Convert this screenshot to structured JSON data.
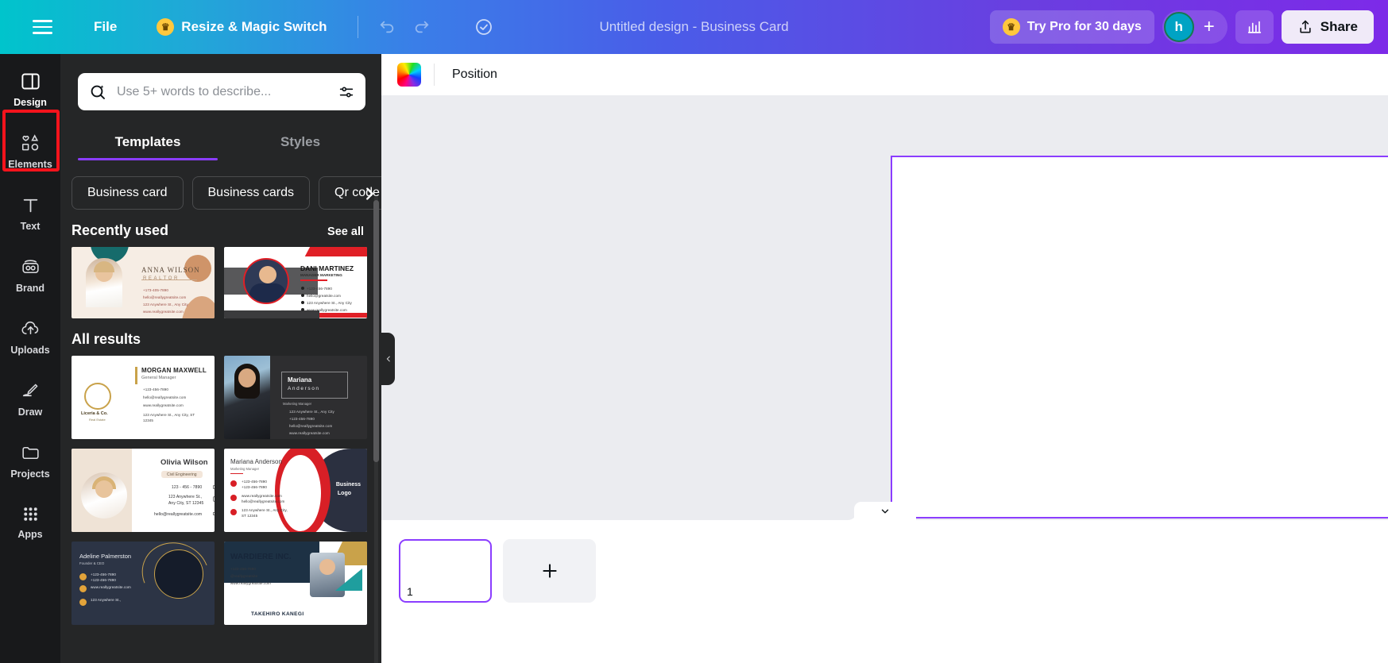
{
  "topbar": {
    "menu_icon": "hamburger-icon",
    "file_label": "File",
    "resize_label": "Resize & Magic Switch",
    "crown_icon": "crown-icon",
    "undo_icon": "undo-icon",
    "redo_icon": "redo-icon",
    "cloud_saved_icon": "cloud-check-icon",
    "design_title": "Untitled design - Business Card",
    "try_pro_label": "Try Pro for 30 days",
    "avatar_initial": "h",
    "add_member_icon": "plus-icon",
    "insights_icon": "bar-chart-icon",
    "share_label": "Share",
    "share_icon": "upload-icon",
    "gradient_start": "#00c4cc",
    "gradient_end": "#7d2ae8"
  },
  "rail": {
    "items": [
      {
        "label": "Design",
        "icon": "layout-panel-icon",
        "active": true
      },
      {
        "label": "Elements",
        "icon": "shapes-icon",
        "active": false
      },
      {
        "label": "Text",
        "icon": "text-t-icon",
        "active": false
      },
      {
        "label": "Brand",
        "icon": "brand-co-icon",
        "active": false
      },
      {
        "label": "Uploads",
        "icon": "cloud-upload-icon",
        "active": false
      },
      {
        "label": "Draw",
        "icon": "pencil-draw-icon",
        "active": false
      },
      {
        "label": "Projects",
        "icon": "folder-icon",
        "active": false
      },
      {
        "label": "Apps",
        "icon": "grid-dots-icon",
        "active": false
      }
    ],
    "highlight_color": "#f4131c"
  },
  "panel": {
    "search": {
      "placeholder": "Use 5+ words to describe...",
      "value": "",
      "magic_search_icon": "magic-search-icon",
      "filter_icon": "sliders-icon"
    },
    "tabs": [
      {
        "label": "Templates",
        "active": true
      },
      {
        "label": "Styles",
        "active": false
      }
    ],
    "active_tab_underline_color": "#8b3dff",
    "chips": [
      "Business card",
      "Business cards",
      "Qr code"
    ],
    "chips_next_icon": "chevron-right-icon",
    "sections": [
      {
        "title": "Recently used",
        "action_label": "See all",
        "cards": [
          {
            "name": "ANNA WILSON",
            "role": "REALTOR",
            "lines": [
              "+173-405-7890",
              "hello@reallygreatsite.com",
              "123 Anywhere St., Any City",
              "www.reallygreatsite.com"
            ],
            "style": "anna",
            "selected": false
          },
          {
            "name": "DANI MARTINEZ",
            "role": "MANAGER MARKETING",
            "lines": [
              "+123-456-7890",
              "hello@greatsite.com",
              "123 Anywhere St., Any City",
              "www.reallygreatsite.com"
            ],
            "style": "dani",
            "selected": false
          }
        ]
      },
      {
        "title": "All results",
        "action_label": "",
        "cards": [
          {
            "name": "MORGAN MAXWELL",
            "role": "General Manager",
            "lines": [
              "+123-456-7890",
              "hello@reallygreatsite.com",
              "www.reallygreatsite.com",
              "123 Anywhere St., Any City, ST 12345"
            ],
            "brand": "Liceria & Co.",
            "brand_sub": "Real Estate",
            "style": "morgan",
            "selected": false
          },
          {
            "name": "Mariana",
            "name2": "Anderson",
            "role": "Marketing Manager",
            "lines": [
              "123 Anywhere St., Any City",
              "+123-456-7890",
              "hello@reallygreatsite.com",
              "www.reallygreatsite.com"
            ],
            "style": "mariana-dark",
            "selected": false
          },
          {
            "name": "Olivia Wilson",
            "role": "Civil Engineering",
            "lines": [
              "123 - 456 - 7890",
              "123 Anywhere St.,",
              "Any City, ST 12345",
              "hello@reallygreatsite.com"
            ],
            "style": "olivia",
            "selected": true
          },
          {
            "name": "Mariana Anderson",
            "role": "Marketing Manager",
            "lines": [
              "+123-456-7890",
              "+123-456-7890",
              "www.reallygreatsite.com",
              "hello@reallygreatsite.com",
              "123 Anywhere St., Any City, ST 12345"
            ],
            "logo_text": "Business",
            "logo_text2": "Logo",
            "style": "mariana-red",
            "selected": false
          },
          {
            "name": "Adeline Palmerston",
            "role": "Founder & CEO",
            "lines": [
              "+123-456-7890",
              "+123-456-7890",
              "www.reallygreatsite.com",
              "123 Anywhere St.,"
            ],
            "style": "adeline",
            "selected": false
          },
          {
            "name": "WARDIERE INC.",
            "role": "",
            "sub_name": "TAKEHIRO KANEGI",
            "lines": [
              "+123-456-7890",
              "@reallygreatsite",
              "www.reallygreatsite.com"
            ],
            "style": "wardiere",
            "selected": false
          }
        ]
      }
    ],
    "collapse_icon": "chevron-left-icon",
    "selected_card_outline_color": "#f4131c"
  },
  "toolbar": {
    "color_swatch_name": "rainbow-color-swatch",
    "position_label": "Position"
  },
  "canvas": {
    "border_color": "#8b3dff",
    "background": "#ffffff",
    "comment_icon": "comment-icon",
    "magic_icon": "magic-sparkle-icon",
    "collapse_icon": "chevron-down-icon"
  },
  "pagebar": {
    "pages": [
      {
        "number": "1",
        "selected": true
      }
    ],
    "add_page_icon": "plus-icon",
    "selected_outline_color": "#8b3dff"
  }
}
